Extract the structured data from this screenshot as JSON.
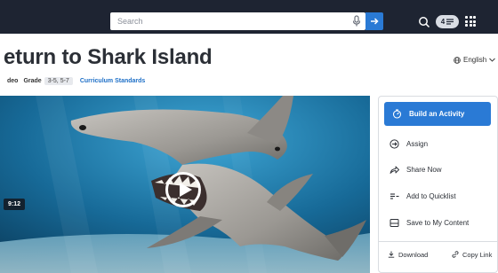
{
  "header": {
    "search_placeholder": "Search",
    "badge_count": "4",
    "icons": [
      "mic-icon",
      "arrow-right-icon",
      "search-icon",
      "list-icon",
      "grid-icon"
    ]
  },
  "page": {
    "title": "eturn to Shark Island",
    "language": "English",
    "type": "deo",
    "grade_label": "Grade",
    "grade_value": "3-5, 5-7",
    "standards_link": "Curriculum Standards"
  },
  "video": {
    "duration": "9:12"
  },
  "actions": {
    "primary": "Build an Activity",
    "items": [
      {
        "label": "Assign",
        "icon": "arrow-circle-icon"
      },
      {
        "label": "Share Now",
        "icon": "share-icon"
      },
      {
        "label": "Add to Quicklist",
        "icon": "quicklist-icon"
      },
      {
        "label": "Save to My Content",
        "icon": "save-icon"
      }
    ],
    "download": "Download",
    "copy_link": "Copy Link"
  },
  "colors": {
    "header_bg": "#1e2432",
    "accent": "#2a7ad5",
    "link": "#1d6fc7"
  }
}
